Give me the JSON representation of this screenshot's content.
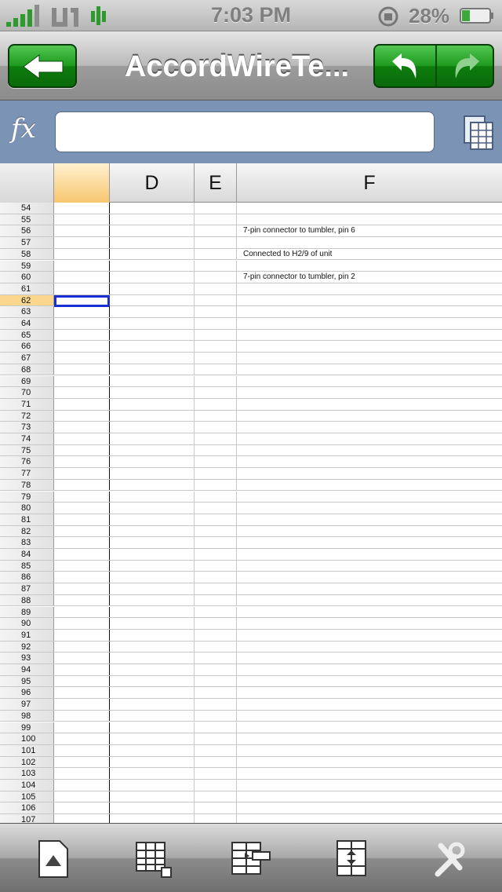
{
  "status": {
    "time": "7:03 PM",
    "battery": "28%"
  },
  "nav": {
    "title": "AccordWireTe...",
    "back_icon": "back-arrow-icon",
    "undo_icon": "undo-icon",
    "redo_icon": "redo-icon"
  },
  "formula": {
    "fx_label": "fx",
    "value": ""
  },
  "columns": [
    "",
    "D",
    "E",
    "F"
  ],
  "rows": [
    {
      "n": "54",
      "f": ""
    },
    {
      "n": "55",
      "f": ""
    },
    {
      "n": "56",
      "f": "7-pin connector to tumbler, pin 6"
    },
    {
      "n": "57",
      "f": ""
    },
    {
      "n": "58",
      "f": "Connected to H2/9 of unit"
    },
    {
      "n": "59",
      "f": ""
    },
    {
      "n": "60",
      "f": "7-pin connector to tumbler, pin 2"
    },
    {
      "n": "61",
      "f": ""
    },
    {
      "n": "62",
      "f": ""
    },
    {
      "n": "63",
      "f": ""
    },
    {
      "n": "64",
      "f": ""
    },
    {
      "n": "65",
      "f": ""
    },
    {
      "n": "66",
      "f": ""
    },
    {
      "n": "67",
      "f": ""
    },
    {
      "n": "68",
      "f": ""
    },
    {
      "n": "69",
      "f": ""
    },
    {
      "n": "70",
      "f": ""
    },
    {
      "n": "71",
      "f": ""
    },
    {
      "n": "72",
      "f": ""
    },
    {
      "n": "73",
      "f": ""
    },
    {
      "n": "74",
      "f": ""
    },
    {
      "n": "75",
      "f": ""
    },
    {
      "n": "76",
      "f": ""
    },
    {
      "n": "77",
      "f": ""
    },
    {
      "n": "78",
      "f": ""
    },
    {
      "n": "79",
      "f": ""
    },
    {
      "n": "80",
      "f": ""
    },
    {
      "n": "81",
      "f": ""
    },
    {
      "n": "82",
      "f": ""
    },
    {
      "n": "83",
      "f": ""
    },
    {
      "n": "84",
      "f": ""
    },
    {
      "n": "85",
      "f": ""
    },
    {
      "n": "86",
      "f": ""
    },
    {
      "n": "87",
      "f": ""
    },
    {
      "n": "88",
      "f": ""
    },
    {
      "n": "89",
      "f": ""
    },
    {
      "n": "90",
      "f": ""
    },
    {
      "n": "91",
      "f": ""
    },
    {
      "n": "92",
      "f": ""
    },
    {
      "n": "93",
      "f": ""
    },
    {
      "n": "94",
      "f": ""
    },
    {
      "n": "95",
      "f": ""
    },
    {
      "n": "96",
      "f": ""
    },
    {
      "n": "97",
      "f": ""
    },
    {
      "n": "98",
      "f": ""
    },
    {
      "n": "99",
      "f": ""
    },
    {
      "n": "100",
      "f": ""
    },
    {
      "n": "101",
      "f": ""
    },
    {
      "n": "102",
      "f": ""
    },
    {
      "n": "103",
      "f": ""
    },
    {
      "n": "104",
      "f": ""
    },
    {
      "n": "105",
      "f": ""
    },
    {
      "n": "106",
      "f": ""
    },
    {
      "n": "107",
      "f": ""
    }
  ],
  "selected_row": "62",
  "toolbar": {
    "items": [
      "file-icon",
      "cell-format-icon",
      "insert-column-icon",
      "insert-row-icon",
      "tools-icon"
    ]
  },
  "colors": {
    "nav_green": "#1d9a1d",
    "formula_bar": "#7b93b5",
    "selection": "#1a2fd2",
    "header_highlight": "#f7c66f"
  }
}
